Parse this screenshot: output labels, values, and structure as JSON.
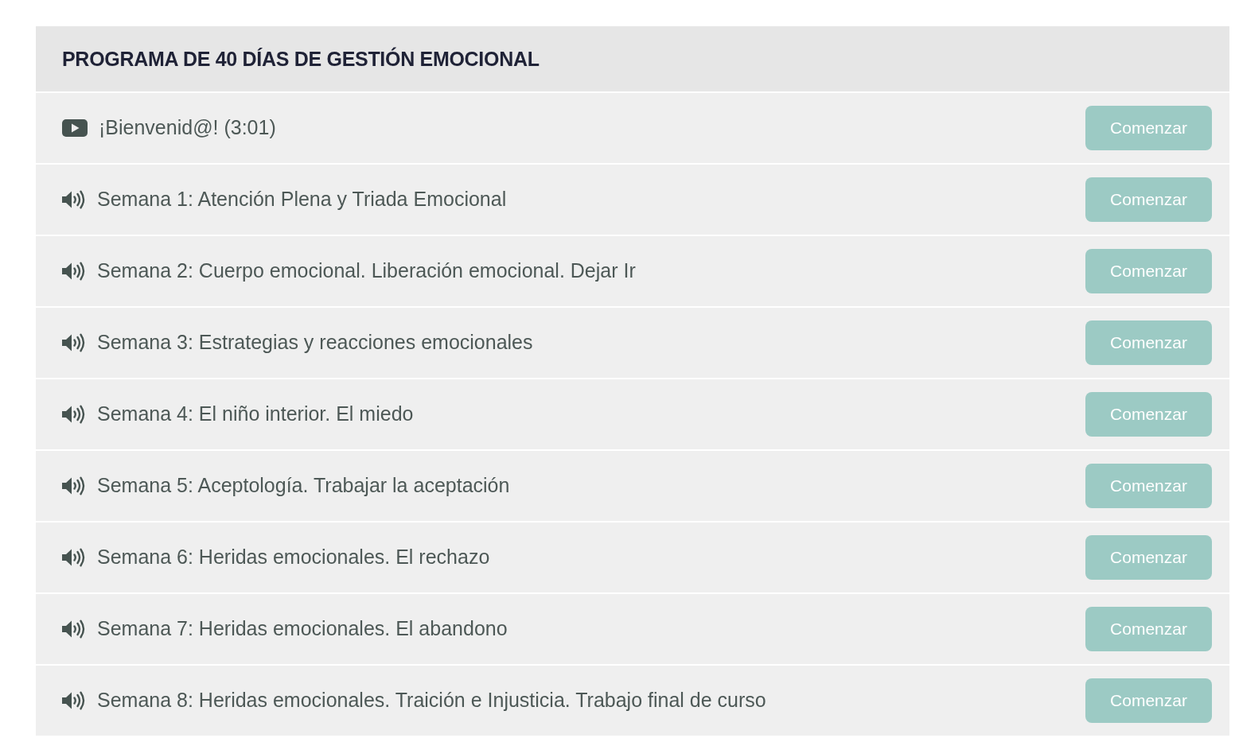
{
  "course": {
    "title": "PROGRAMA DE 40 DÍAS DE GESTIÓN EMOCIONAL",
    "lessons": [
      {
        "kind": "video",
        "title": "¡Bienvenid@! (3:01)",
        "button": "Comenzar"
      },
      {
        "kind": "audio",
        "title": "Semana 1: Atención Plena y Triada Emocional",
        "button": "Comenzar"
      },
      {
        "kind": "audio",
        "title": "Semana 2: Cuerpo emocional. Liberación emocional. Dejar Ir",
        "button": "Comenzar"
      },
      {
        "kind": "audio",
        "title": "Semana 3: Estrategias y reacciones emocionales",
        "button": "Comenzar"
      },
      {
        "kind": "audio",
        "title": "Semana 4: El niño interior. El miedo",
        "button": "Comenzar"
      },
      {
        "kind": "audio",
        "title": "Semana 5: Aceptología. Trabajar la aceptación",
        "button": "Comenzar"
      },
      {
        "kind": "audio",
        "title": "Semana 6: Heridas emocionales. El rechazo",
        "button": "Comenzar"
      },
      {
        "kind": "audio",
        "title": "Semana 7: Heridas emocionales. El abandono",
        "button": "Comenzar"
      },
      {
        "kind": "audio",
        "title": "Semana 8: Heridas emocionales. Traición e Injusticia. Trabajo final de curso",
        "button": "Comenzar"
      }
    ]
  }
}
